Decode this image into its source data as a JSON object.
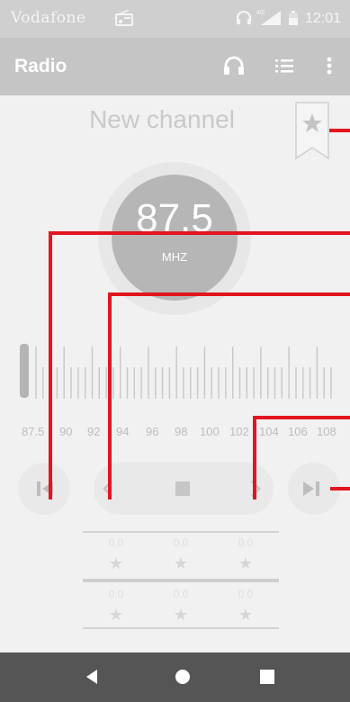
{
  "status_bar": {
    "carrier": "Vodafone",
    "network_badge": "4G",
    "time": "12:01",
    "icons": [
      "radio-icon",
      "headset-icon",
      "signal-icon",
      "battery-icon"
    ]
  },
  "app_bar": {
    "title": "Radio",
    "actions": [
      "headphones-icon",
      "playlist-icon",
      "more-vert-icon"
    ]
  },
  "station": {
    "name": "New channel",
    "frequency": "87.5",
    "unit": "MHZ",
    "favorite_icon": "bookmark-star-icon"
  },
  "tuner": {
    "labels": [
      "87.5",
      "90",
      "92",
      "94",
      "96",
      "98",
      "100",
      "102",
      "104",
      "106",
      "108"
    ],
    "current": 87.5,
    "range": [
      87.5,
      108
    ]
  },
  "controls": [
    "skip-previous-icon",
    "seek-back-icon",
    "stop-icon",
    "seek-forward-icon",
    "skip-next-icon"
  ],
  "favorites": [
    {
      "freq": "0.0",
      "star": "★"
    },
    {
      "freq": "0.0",
      "star": "★"
    },
    {
      "freq": "0.0",
      "star": "★"
    },
    {
      "freq": "0.0",
      "star": "★"
    },
    {
      "freq": "0.0",
      "star": "★"
    },
    {
      "freq": "0.0",
      "star": "★"
    }
  ],
  "nav_bar": [
    "back-icon",
    "home-icon",
    "recents-icon"
  ],
  "colors": {
    "callout": "#e3151e",
    "dial": "#b6b6b6",
    "nav_bar": "#555555"
  }
}
